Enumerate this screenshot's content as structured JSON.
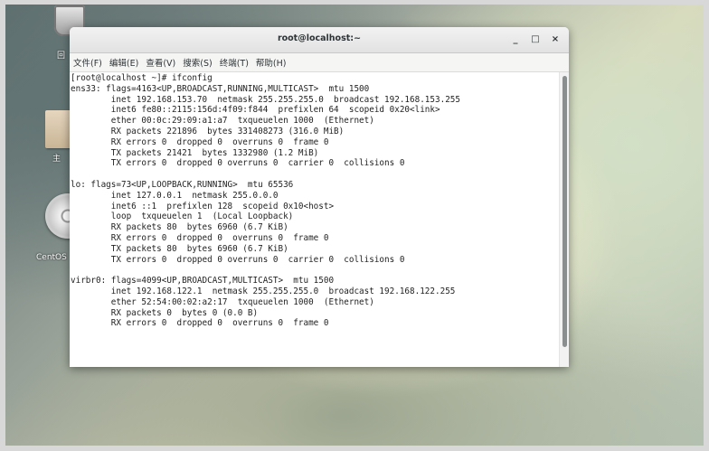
{
  "desktop": {
    "trash_label": "回",
    "folder_label": "主",
    "disc_label": "CentOS"
  },
  "window": {
    "title": "root@localhost:~",
    "controls": {
      "minimize": "_",
      "maximize": "□",
      "close": "×"
    },
    "menu": [
      "文件(F)",
      "编辑(E)",
      "查看(V)",
      "搜索(S)",
      "终端(T)",
      "帮助(H)"
    ]
  },
  "terminal": {
    "lines": [
      "[root@localhost ~]# ifconfig",
      "ens33: flags=4163<UP,BROADCAST,RUNNING,MULTICAST>  mtu 1500",
      "        inet 192.168.153.70  netmask 255.255.255.0  broadcast 192.168.153.255",
      "        inet6 fe80::2115:156d:4f09:f844  prefixlen 64  scopeid 0x20<link>",
      "        ether 00:0c:29:09:a1:a7  txqueuelen 1000  (Ethernet)",
      "        RX packets 221896  bytes 331408273 (316.0 MiB)",
      "        RX errors 0  dropped 0  overruns 0  frame 0",
      "        TX packets 21421  bytes 1332980 (1.2 MiB)",
      "        TX errors 0  dropped 0 overruns 0  carrier 0  collisions 0",
      "",
      "lo: flags=73<UP,LOOPBACK,RUNNING>  mtu 65536",
      "        inet 127.0.0.1  netmask 255.0.0.0",
      "        inet6 ::1  prefixlen 128  scopeid 0x10<host>",
      "        loop  txqueuelen 1  (Local Loopback)",
      "        RX packets 80  bytes 6960 (6.7 KiB)",
      "        RX errors 0  dropped 0  overruns 0  frame 0",
      "        TX packets 80  bytes 6960 (6.7 KiB)",
      "        TX errors 0  dropped 0 overruns 0  carrier 0  collisions 0",
      "",
      "virbr0: flags=4099<UP,BROADCAST,MULTICAST>  mtu 1500",
      "        inet 192.168.122.1  netmask 255.255.255.0  broadcast 192.168.122.255",
      "        ether 52:54:00:02:a2:17  txqueuelen 1000  (Ethernet)",
      "        RX packets 0  bytes 0 (0.0 B)",
      "        RX errors 0  dropped 0  overruns 0  frame 0"
    ]
  }
}
